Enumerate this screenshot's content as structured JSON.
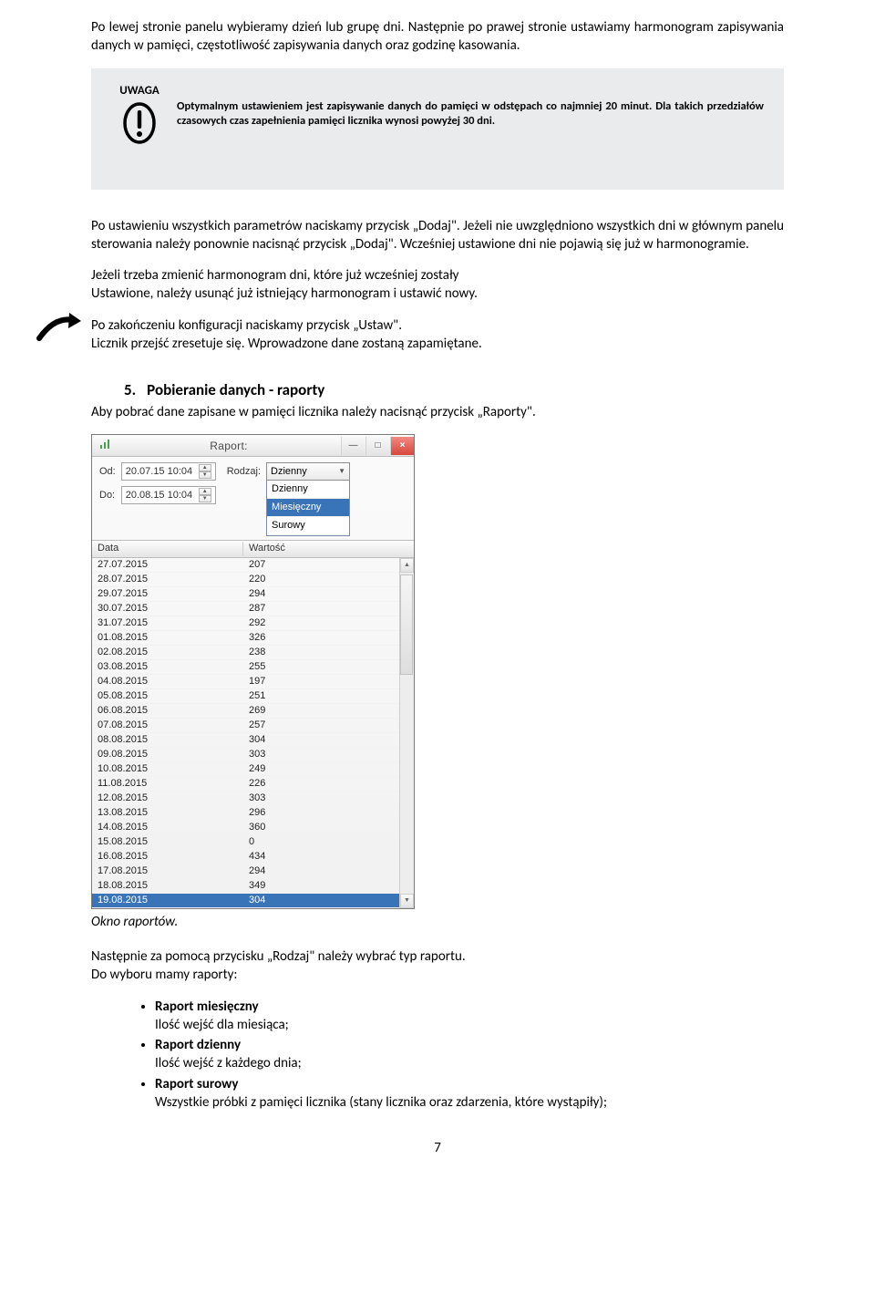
{
  "para_intro": "Po lewej stronie panelu wybieramy dzień lub grupę dni. Następnie po prawej stronie ustawiamy harmonogram zapisywania danych w pamięci, częstotliwość zapisywania danych oraz godzinę kasowania.",
  "uwaga": {
    "label": "UWAGA",
    "text": "Optymalnym ustawieniem jest zapisywanie danych do pamięci w odstępach co najmniej 20 minut. Dla takich przedziałów czasowych czas zapełnienia pamięci licznika wynosi powyżej 30 dni."
  },
  "para_dodaj": "Po ustawieniu wszystkich parametrów naciskamy przycisk „Dodaj\". Jeżeli nie uwzględniono wszystkich dni w głównym panelu sterowania należy ponownie nacisnąć przycisk „Dodaj\". Wcześniej ustawione dni nie pojawią się już w harmonogramie.",
  "para_change": "Jeżeli trzeba zmienić harmonogram dni, które już wcześniej zostały\nUstawione, należy usunąć już istniejący harmonogram i ustawić nowy.",
  "para_ustaw": "Po zakończeniu konfiguracji naciskamy przycisk „Ustaw\".\nLicznik przejść zresetuje się. Wprowadzone dane zostaną zapamiętane.",
  "section": {
    "num": "5.",
    "title": "Pobieranie danych - raporty"
  },
  "section_lead": "Aby pobrać dane zapisane w pamięci licznika należy nacisnąć przycisk „Raporty\".",
  "window": {
    "title": "Raport:",
    "od_lbl": "Od:",
    "do_lbl": "Do:",
    "od_val": "20.07.15 10:04",
    "do_val": "20.08.15 10:04",
    "rodzaj_lbl": "Rodzaj:",
    "rodzaj_selected": "Dzienny",
    "rodzaj_options": [
      "Dzienny",
      "Miesięczny",
      "Surowy"
    ],
    "col1": "Data",
    "col2": "Wartość",
    "rows": [
      [
        "27.07.2015",
        "207"
      ],
      [
        "28.07.2015",
        "220"
      ],
      [
        "29.07.2015",
        "294"
      ],
      [
        "30.07.2015",
        "287"
      ],
      [
        "31.07.2015",
        "292"
      ],
      [
        "01.08.2015",
        "326"
      ],
      [
        "02.08.2015",
        "238"
      ],
      [
        "03.08.2015",
        "255"
      ],
      [
        "04.08.2015",
        "197"
      ],
      [
        "05.08.2015",
        "251"
      ],
      [
        "06.08.2015",
        "269"
      ],
      [
        "07.08.2015",
        "257"
      ],
      [
        "08.08.2015",
        "304"
      ],
      [
        "09.08.2015",
        "303"
      ],
      [
        "10.08.2015",
        "249"
      ],
      [
        "11.08.2015",
        "226"
      ],
      [
        "12.08.2015",
        "303"
      ],
      [
        "13.08.2015",
        "296"
      ],
      [
        "14.08.2015",
        "360"
      ],
      [
        "15.08.2015",
        "0"
      ],
      [
        "16.08.2015",
        "434"
      ],
      [
        "17.08.2015",
        "294"
      ],
      [
        "18.08.2015",
        "349"
      ],
      [
        "19.08.2015",
        "304"
      ]
    ],
    "highlight_index": 23
  },
  "caption": "Okno raportów.",
  "para_next": "Następnie za pomocą przycisku „Rodzaj\" należy wybrać typ raportu.\nDo wyboru mamy raporty:",
  "options": [
    {
      "title": "Raport miesięczny",
      "sub": "Ilość wejść dla miesiąca;"
    },
    {
      "title": "Raport dzienny",
      "sub": "Ilość wejść z każdego dnia;"
    },
    {
      "title": "Raport surowy",
      "sub": "Wszystkie próbki z pamięci licznika (stany licznika oraz zdarzenia, które  wystąpiły);"
    }
  ],
  "pagenum": "7"
}
